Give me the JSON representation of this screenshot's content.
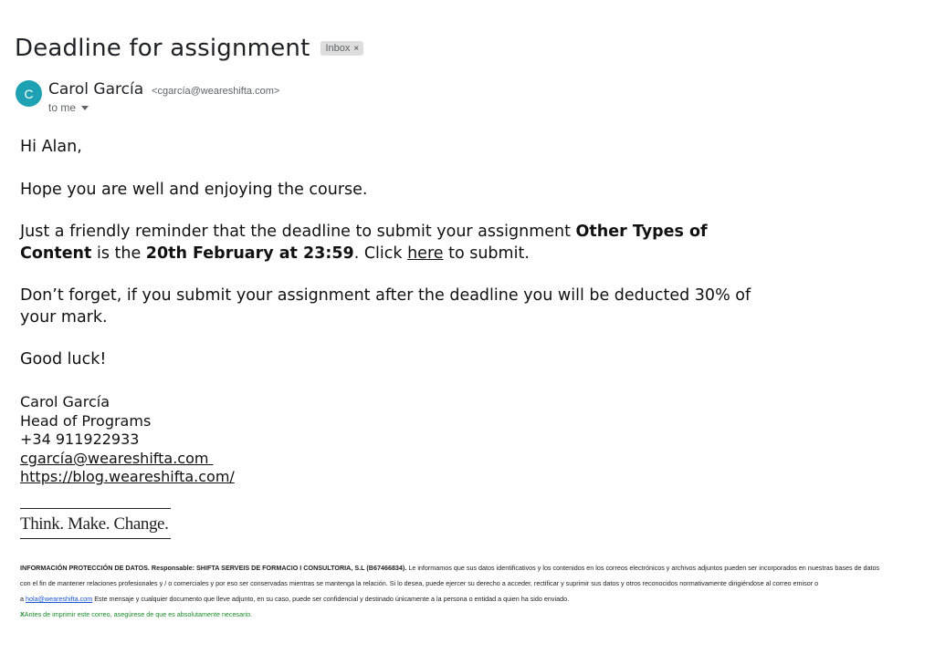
{
  "email": {
    "subject": "Deadline for assignment",
    "label": "Inbox",
    "label_close": "×"
  },
  "sender": {
    "avatar_initial": "C",
    "name": "Carol García",
    "email": "<cgarcía@weareshifta.com>",
    "to": "to me"
  },
  "body": {
    "greeting": "Hi Alan,",
    "p1": "Hope you are well and enjoying the course.",
    "p2_a": "Just a friendly reminder that the deadline to submit your assignment ",
    "p2_b_bold": "Other Types of Content",
    "p2_c": " is the ",
    "p2_d_bold": "20th February at 23:59",
    "p2_e": ". Click ",
    "p2_link": "here",
    "p2_f": " to submit.",
    "p3": "Don’t forget, if you submit your assignment after the deadline you will be deducted 30% of your mark.",
    "closing": "Good luck!"
  },
  "signature": {
    "name": "Carol García",
    "role": "Head of Programs",
    "phone": "+34 911922933",
    "email": "cgarcía@weareshifta.com ",
    "url": "https://blog.weareshifta.com/",
    "tagline": "Think. Make. Change."
  },
  "legal": {
    "l1_bold": "INFORMACIÓN PROTECCIÓN DE DATOS. Responsable: SHIFTA SERVEIS DE FORMACIO I CONSULTORIA, S.L (B67466834).",
    "l1_rest": " Le informamos que sus datos identificativos y los contenidos en los correos electrónicos y archivos adjuntos pueden ser incorporados en nuestras bases de datos",
    "l2": "con el fin de mantener relaciones profesionales y / o comerciales y por eso ser conservadas mientras se mantenga la relación. Si lo desea, puede ejercer su derecho a acceder, rectificar y suprimir sus datos y otros reconocidos normativamente dirigiéndose al correo emisor o",
    "l3_prefix": "a ",
    "l3_link": "hola@weareshifta.com",
    "l3_rest": " Este mensaje y cualquier documento que lleve adjunto, en su caso, puede ser confidencial y destinado únicamente a la persona o entidad a quien ha sido enviado.",
    "l4_bold": "X",
    "l4_rest": "Antes de imprimir este correo, asegúrese de que es absolutamente necesario."
  },
  "colors": {
    "avatar": "#1ea1b3",
    "legal_link": "#1a55d6",
    "eco_note": "#1b8a2a",
    "chip_bg": "#dddddd"
  }
}
